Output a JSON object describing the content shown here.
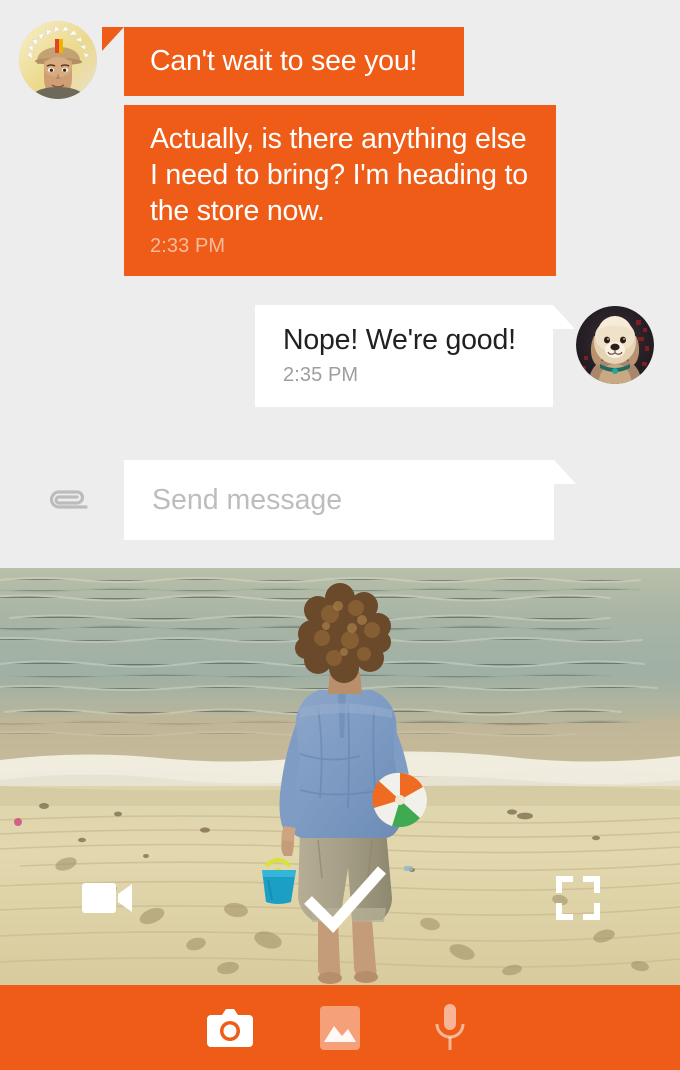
{
  "theme": {
    "accent_orange": "#ee5c18",
    "background_grey": "#ededed",
    "bubble_white": "#ffffff",
    "incoming_text": "#ffffff",
    "outgoing_text": "#212121",
    "timestamp_incoming": "#f8bb9c",
    "timestamp_outgoing": "#9e9e9e",
    "placeholder_grey": "#bdbdbd"
  },
  "conversation": {
    "messages": [
      {
        "id": "msg-1",
        "direction": "incoming",
        "sender": "friend",
        "text": "Can't wait to see you!",
        "time": "",
        "avatar_name": "avatar-friend"
      },
      {
        "id": "msg-2",
        "direction": "incoming",
        "sender": "friend",
        "text": "Actually, is there anything else I need to bring? I'm heading to the store now.",
        "time": "2:33 PM",
        "avatar_name": ""
      },
      {
        "id": "msg-3",
        "direction": "outgoing",
        "sender": "me",
        "text": "Nope! We're good!",
        "time": "2:35 PM",
        "avatar_name": "avatar-me"
      }
    ]
  },
  "composer": {
    "placeholder": "Send message",
    "value": "",
    "attach_icon": "paperclip-icon",
    "avatar_icon": "avatar-me"
  },
  "photo_preview": {
    "description": "Beach photo: person in blue shirt walking toward the ocean carrying a beach ball and a blue bucket",
    "overlays": [
      {
        "name": "video-mode-toggle-button",
        "icon": "video-camera-icon",
        "state": "active"
      },
      {
        "name": "confirm-photo-button",
        "icon": "checkmark-icon",
        "state": "active"
      },
      {
        "name": "expand-fullscreen-button",
        "icon": "fullscreen-expand-icon",
        "state": "active"
      }
    ]
  },
  "bottom_toolbar": {
    "items": [
      {
        "name": "camera-button",
        "icon": "camera-icon",
        "selected": true,
        "label": "Camera"
      },
      {
        "name": "gallery-button",
        "icon": "image-icon",
        "selected": false,
        "label": "Gallery"
      },
      {
        "name": "microphone-button",
        "icon": "microphone-icon",
        "selected": false,
        "label": "Voice"
      }
    ]
  }
}
